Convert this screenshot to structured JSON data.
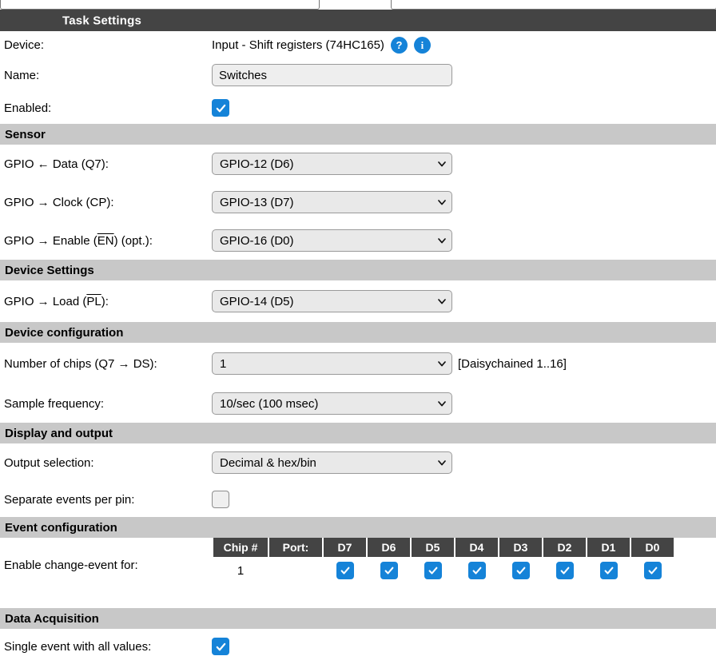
{
  "titlebar": {
    "title": "Task Settings"
  },
  "task": {
    "device_label": "Device:",
    "device_value": "Input - Shift registers (74HC165)",
    "help_icon_label": "?",
    "info_icon_label": "i",
    "name_label": "Name:",
    "name_value": "Switches",
    "name_placeholder": "",
    "enabled_label": "Enabled:",
    "enabled_checked": true
  },
  "sensor": {
    "header": "Sensor",
    "rows": [
      {
        "label_pre": "GPIO ← Data (Q7):",
        "value": "GPIO-12 (D6)"
      },
      {
        "label_pre": "GPIO → Clock (CP):",
        "value": "GPIO-13 (D7)"
      },
      {
        "label_pre": "GPIO → Enable (",
        "label_over": "EN",
        "label_post": ") (opt.):",
        "value": "GPIO-16 (D0)"
      }
    ]
  },
  "device_settings": {
    "header": "Device Settings",
    "load_label_pre": "GPIO → Load (",
    "load_label_over": "PL",
    "load_label_post": "):",
    "load_value": "GPIO-14 (D5)"
  },
  "device_configuration": {
    "header": "Device configuration",
    "chips_label": "Number of chips (Q7 → DS):",
    "chips_value": "1",
    "chips_note": "[Daisychained 1..16]",
    "sample_label": "Sample frequency:",
    "sample_value": "10/sec (100 msec)"
  },
  "display_output": {
    "header": "Display and output",
    "output_label": "Output selection:",
    "output_value": "Decimal & hex/bin",
    "separate_label": "Separate events per pin:",
    "separate_checked": false
  },
  "event_configuration": {
    "header": "Event configuration",
    "row_label": "Enable change-event for:",
    "columns": [
      "Chip #",
      "Port:",
      "D7",
      "D6",
      "D5",
      "D4",
      "D3",
      "D2",
      "D1",
      "D0"
    ],
    "rows": [
      {
        "chip": "1",
        "port": "",
        "checks": [
          true,
          true,
          true,
          true,
          true,
          true,
          true,
          true
        ]
      }
    ]
  },
  "data_acquisition": {
    "header": "Data Acquisition",
    "single_event_label": "Single event with all values:",
    "single_event_checked": true
  },
  "colors": {
    "titlebar_bg": "#444444",
    "section_bg": "#c8c8c8",
    "accent_blue": "#1583d8",
    "field_bg": "#e9e9e9",
    "page_bg": "#ffffff"
  }
}
